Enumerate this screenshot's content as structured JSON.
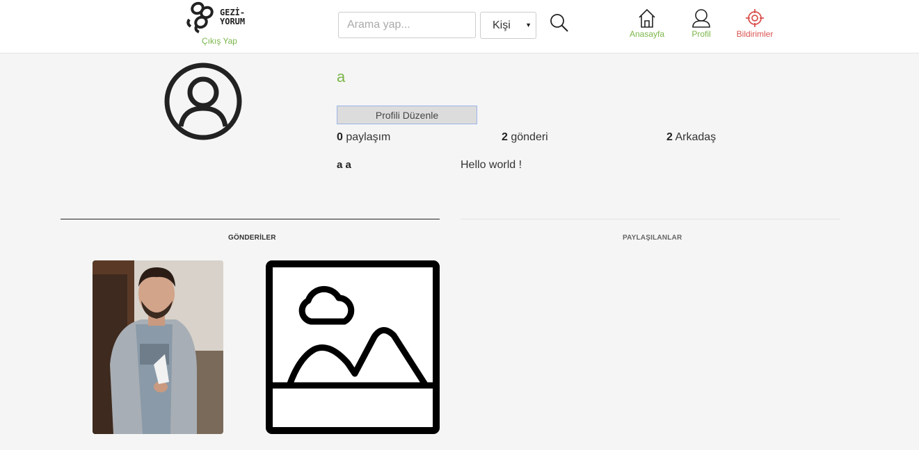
{
  "header": {
    "logo_text_line1": "GEZİ-",
    "logo_text_line2": "YORUM",
    "logout_label": "Çıkış Yap",
    "search": {
      "placeholder": "Arama yap...",
      "value": "",
      "type_selected": "Kişi"
    },
    "nav": [
      {
        "label": "Anasayfa",
        "icon": "home-icon"
      },
      {
        "label": "Profil",
        "icon": "user-icon"
      },
      {
        "label": "Bildirimler",
        "icon": "target-icon"
      }
    ]
  },
  "profile": {
    "username": "a",
    "edit_button_label": "Profili Düzenle",
    "stats": {
      "shares_count": "0",
      "shares_label": "paylaşım",
      "sends_count": "2",
      "sends_label": "gönderi",
      "friends_count": "2",
      "friends_label": "Arkadaş"
    },
    "full_name": "a a",
    "bio": "Hello world !"
  },
  "tabs": [
    {
      "label": "GÖNDERİLER",
      "active": true
    },
    {
      "label": "PAYLAŞILANLAR",
      "active": false
    }
  ],
  "posts": [
    {
      "kind": "photo"
    },
    {
      "kind": "image-placeholder"
    }
  ],
  "colors": {
    "accent_green": "#7ab648",
    "notification_red": "#d9534f",
    "background": "#f5f5f5"
  }
}
